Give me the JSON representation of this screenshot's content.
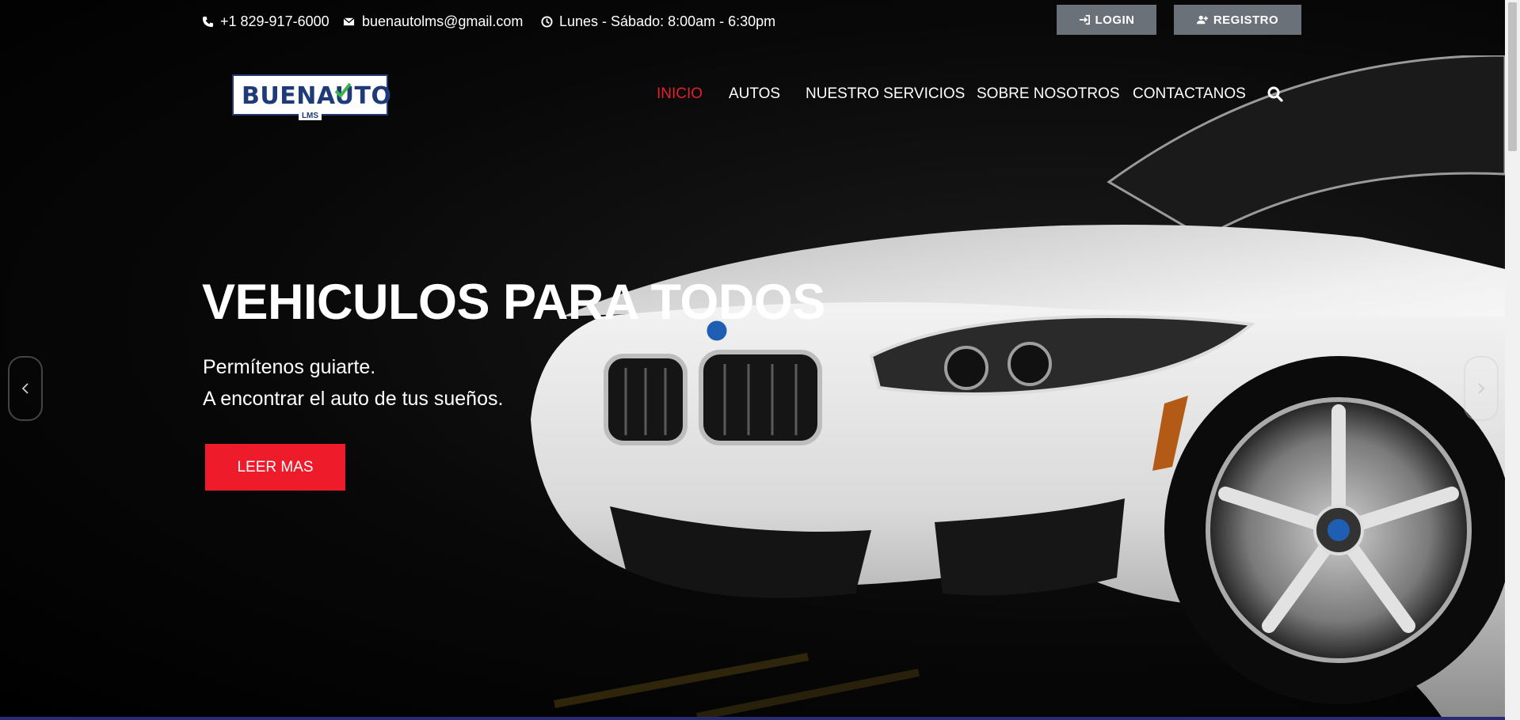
{
  "topbar": {
    "phone": "+1 829-917-6000",
    "email": "buenautolms@gmail.com",
    "hours": "Lunes - Sábado: 8:00am - 6:30pm",
    "login_label": "LOGIN",
    "register_label": "REGISTRO"
  },
  "logo": {
    "main": "BUENAUTO",
    "sub": "LMS"
  },
  "nav": {
    "items": [
      {
        "label": "INICIO",
        "active": true
      },
      {
        "label": "AUTOS"
      },
      {
        "label": "NUESTRO SERVICIOS"
      },
      {
        "label": "SOBRE NOSOTROS"
      },
      {
        "label": "CONTACTANOS"
      }
    ]
  },
  "hero": {
    "title": "VEHICULOS PARA TODOS",
    "line1": "Permítenos guiarte.",
    "line2": "A encontrar el auto de tus sueños.",
    "cta_label": "LEER MAS"
  },
  "colors": {
    "accent": "#ee1c2a",
    "button_gray": "#6b7178",
    "logo_blue": "#1f3a78",
    "logo_green": "#3bb54a"
  },
  "icons": [
    "phone-icon",
    "envelope-icon",
    "clock-icon",
    "sign-in-icon",
    "user-plus-icon",
    "search-icon",
    "chevron-left-icon",
    "chevron-right-icon"
  ]
}
